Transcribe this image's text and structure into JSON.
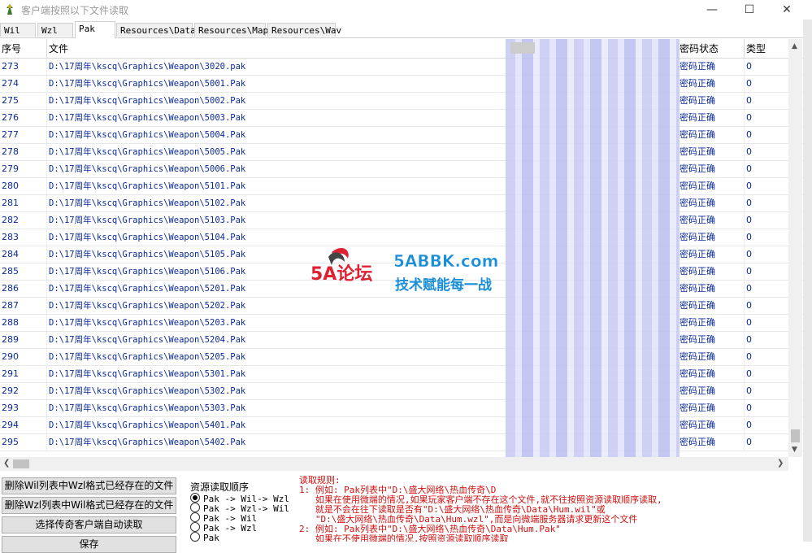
{
  "window": {
    "title": "客户端按照以下文件读取"
  },
  "tabs": [
    "Wil",
    "Wzl",
    "Pak",
    "Resources\\Data",
    "Resources\\Map",
    "Resources\\Wav"
  ],
  "active_tab": "Pak",
  "columns": {
    "index": "序号",
    "file": "文件",
    "password_status": "密码状态",
    "type": "类型"
  },
  "rows": [
    {
      "n": "273",
      "path": "D:\\17周年\\kscq\\Graphics\\Weapon\\3020.pak",
      "status": "密码正确",
      "type": "0"
    },
    {
      "n": "274",
      "path": "D:\\17周年\\kscq\\Graphics\\Weapon\\5001.Pak",
      "status": "密码正确",
      "type": "0"
    },
    {
      "n": "275",
      "path": "D:\\17周年\\kscq\\Graphics\\Weapon\\5002.Pak",
      "status": "密码正确",
      "type": "0"
    },
    {
      "n": "276",
      "path": "D:\\17周年\\kscq\\Graphics\\Weapon\\5003.Pak",
      "status": "密码正确",
      "type": "0"
    },
    {
      "n": "277",
      "path": "D:\\17周年\\kscq\\Graphics\\Weapon\\5004.Pak",
      "status": "密码正确",
      "type": "0"
    },
    {
      "n": "278",
      "path": "D:\\17周年\\kscq\\Graphics\\Weapon\\5005.Pak",
      "status": "密码正确",
      "type": "0"
    },
    {
      "n": "279",
      "path": "D:\\17周年\\kscq\\Graphics\\Weapon\\5006.Pak",
      "status": "密码正确",
      "type": "0"
    },
    {
      "n": "280",
      "path": "D:\\17周年\\kscq\\Graphics\\Weapon\\5101.Pak",
      "status": "密码正确",
      "type": "0"
    },
    {
      "n": "281",
      "path": "D:\\17周年\\kscq\\Graphics\\Weapon\\5102.Pak",
      "status": "密码正确",
      "type": "0"
    },
    {
      "n": "282",
      "path": "D:\\17周年\\kscq\\Graphics\\Weapon\\5103.Pak",
      "status": "密码正确",
      "type": "0"
    },
    {
      "n": "283",
      "path": "D:\\17周年\\kscq\\Graphics\\Weapon\\5104.Pak",
      "status": "密码正确",
      "type": "0"
    },
    {
      "n": "284",
      "path": "D:\\17周年\\kscq\\Graphics\\Weapon\\5105.Pak",
      "status": "密码正确",
      "type": "0"
    },
    {
      "n": "285",
      "path": "D:\\17周年\\kscq\\Graphics\\Weapon\\5106.Pak",
      "status": "密码正确",
      "type": "0"
    },
    {
      "n": "286",
      "path": "D:\\17周年\\kscq\\Graphics\\Weapon\\5201.Pak",
      "status": "密码正确",
      "type": "0"
    },
    {
      "n": "287",
      "path": "D:\\17周年\\kscq\\Graphics\\Weapon\\5202.Pak",
      "status": "密码正确",
      "type": "0"
    },
    {
      "n": "288",
      "path": "D:\\17周年\\kscq\\Graphics\\Weapon\\5203.Pak",
      "status": "密码正确",
      "type": "0"
    },
    {
      "n": "289",
      "path": "D:\\17周年\\kscq\\Graphics\\Weapon\\5204.Pak",
      "status": "密码正确",
      "type": "0"
    },
    {
      "n": "290",
      "path": "D:\\17周年\\kscq\\Graphics\\Weapon\\5205.Pak",
      "status": "密码正确",
      "type": "0"
    },
    {
      "n": "291",
      "path": "D:\\17周年\\kscq\\Graphics\\Weapon\\5301.Pak",
      "status": "密码正确",
      "type": "0"
    },
    {
      "n": "292",
      "path": "D:\\17周年\\kscq\\Graphics\\Weapon\\5302.Pak",
      "status": "密码正确",
      "type": "0"
    },
    {
      "n": "293",
      "path": "D:\\17周年\\kscq\\Graphics\\Weapon\\5303.Pak",
      "status": "密码正确",
      "type": "0"
    },
    {
      "n": "294",
      "path": "D:\\17周年\\kscq\\Graphics\\Weapon\\5401.Pak",
      "status": "密码正确",
      "type": "0"
    },
    {
      "n": "295",
      "path": "D:\\17周年\\kscq\\Graphics\\Weapon\\5402.Pak",
      "status": "密码正确",
      "type": "0"
    }
  ],
  "buttons": {
    "delete_wil": "删除Wil列表中Wzl格式已经存在的文件",
    "delete_wzl": "删除Wzl列表中Wil格式已经存在的文件",
    "auto_read": "选择传奇客户端自动读取",
    "save": "保存"
  },
  "read_order": {
    "title": "资源读取顺序",
    "options": [
      "Pak -> Wil-> Wzl",
      "Pak -> Wzl-> Wil",
      "Pak -> Wil",
      "Pak -> Wzl",
      "Pak"
    ],
    "selected_index": 0
  },
  "rules": {
    "heading": "读取规则:",
    "lines": [
      "1: 例如: Pak列表中\"D:\\盛大网络\\热血传奇\\D",
      "   如果在使用微端的情况,如果玩家客户端不存在这个文件,就不往按照资源读取顺序读取,",
      "   就是不会在往下读取是否有\"D:\\盛大网络\\热血传奇\\Data\\Hum.wil\"或",
      "   \"D:\\盛大网络\\热血传奇\\Data\\Hum.wzl\",而是向微端服务器请求更新这个文件",
      "2: 例如: Pak列表中\"D:\\盛大网络\\热血传奇\\Data\\Hum.Pak\"",
      "   如果在不使用微端的情况,按照资源读取顺序读取"
    ]
  },
  "watermark": {
    "logo": "5A论坛",
    "site": "5ABBK.com",
    "slogan": "技术赋能每一战"
  },
  "colors": {
    "link_blue": "#0a2a9a",
    "rule_red": "#d01010",
    "blur": "#c6c9f2"
  }
}
